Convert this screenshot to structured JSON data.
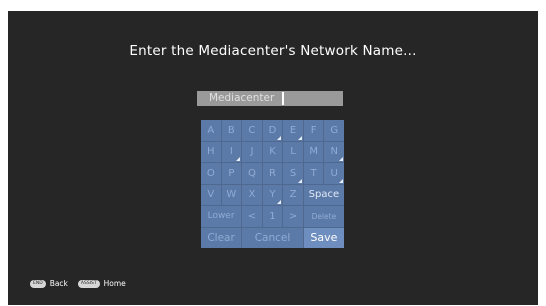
{
  "title": "Enter the Mediacenter's Network Name...",
  "input": {
    "value": "Mediacenter"
  },
  "keyboard": {
    "rows": [
      [
        "A",
        "B",
        "C",
        "D",
        "E",
        "F",
        "G"
      ],
      [
        "H",
        "I",
        "J",
        "K",
        "L",
        "M",
        "N"
      ],
      [
        "O",
        "P",
        "Q",
        "R",
        "S",
        "T",
        "U"
      ],
      [
        "V",
        "W",
        "X",
        "Y",
        "Z",
        "Space"
      ],
      [
        "Lower",
        "<",
        "1",
        ">",
        "Delete"
      ],
      [
        "Clear",
        "Cancel",
        "Save"
      ]
    ]
  },
  "footer": {
    "back_badge": "END",
    "back_label": "Back",
    "home_badge": "ASSIST",
    "home_label": "Home"
  }
}
